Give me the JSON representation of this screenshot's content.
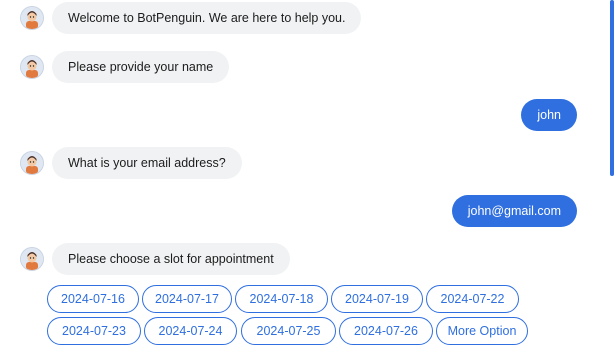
{
  "messages": {
    "bot_1": "Welcome to BotPenguin. We are here to help you.",
    "bot_2": "Please provide your name",
    "user_1": "john",
    "bot_3": "What is your email address?",
    "user_2": "john@gmail.com",
    "bot_4": "Please choose a slot for appointment"
  },
  "slots": {
    "row1": [
      "2024-07-16",
      "2024-07-17",
      "2024-07-18",
      "2024-07-19",
      "2024-07-22"
    ],
    "row2": [
      "2024-07-23",
      "2024-07-24",
      "2024-07-25",
      "2024-07-26",
      "More Option"
    ]
  },
  "colors": {
    "accent": "#2f6fe0",
    "bot_bubble": "#f1f2f4",
    "text": "#1c1c1c"
  },
  "icons": {
    "bot_avatar": "bot-avatar-icon"
  }
}
